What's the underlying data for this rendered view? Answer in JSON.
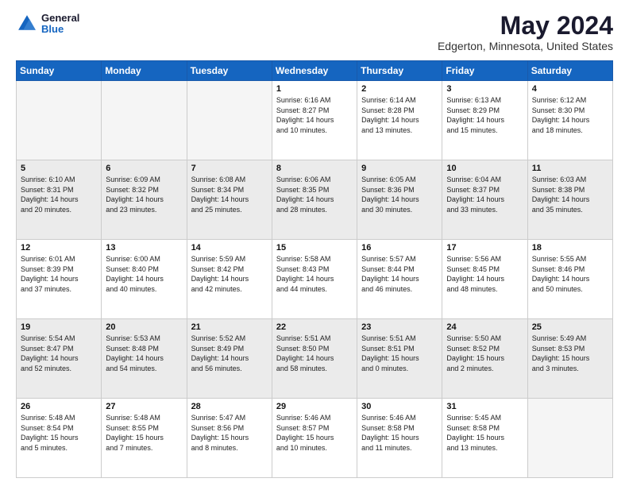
{
  "header": {
    "logo_line1": "General",
    "logo_line2": "Blue",
    "month": "May 2024",
    "location": "Edgerton, Minnesota, United States"
  },
  "days_of_week": [
    "Sunday",
    "Monday",
    "Tuesday",
    "Wednesday",
    "Thursday",
    "Friday",
    "Saturday"
  ],
  "weeks": [
    [
      {
        "day": "",
        "info": ""
      },
      {
        "day": "",
        "info": ""
      },
      {
        "day": "",
        "info": ""
      },
      {
        "day": "1",
        "info": "Sunrise: 6:16 AM\nSunset: 8:27 PM\nDaylight: 14 hours\nand 10 minutes."
      },
      {
        "day": "2",
        "info": "Sunrise: 6:14 AM\nSunset: 8:28 PM\nDaylight: 14 hours\nand 13 minutes."
      },
      {
        "day": "3",
        "info": "Sunrise: 6:13 AM\nSunset: 8:29 PM\nDaylight: 14 hours\nand 15 minutes."
      },
      {
        "day": "4",
        "info": "Sunrise: 6:12 AM\nSunset: 8:30 PM\nDaylight: 14 hours\nand 18 minutes."
      }
    ],
    [
      {
        "day": "5",
        "info": "Sunrise: 6:10 AM\nSunset: 8:31 PM\nDaylight: 14 hours\nand 20 minutes."
      },
      {
        "day": "6",
        "info": "Sunrise: 6:09 AM\nSunset: 8:32 PM\nDaylight: 14 hours\nand 23 minutes."
      },
      {
        "day": "7",
        "info": "Sunrise: 6:08 AM\nSunset: 8:34 PM\nDaylight: 14 hours\nand 25 minutes."
      },
      {
        "day": "8",
        "info": "Sunrise: 6:06 AM\nSunset: 8:35 PM\nDaylight: 14 hours\nand 28 minutes."
      },
      {
        "day": "9",
        "info": "Sunrise: 6:05 AM\nSunset: 8:36 PM\nDaylight: 14 hours\nand 30 minutes."
      },
      {
        "day": "10",
        "info": "Sunrise: 6:04 AM\nSunset: 8:37 PM\nDaylight: 14 hours\nand 33 minutes."
      },
      {
        "day": "11",
        "info": "Sunrise: 6:03 AM\nSunset: 8:38 PM\nDaylight: 14 hours\nand 35 minutes."
      }
    ],
    [
      {
        "day": "12",
        "info": "Sunrise: 6:01 AM\nSunset: 8:39 PM\nDaylight: 14 hours\nand 37 minutes."
      },
      {
        "day": "13",
        "info": "Sunrise: 6:00 AM\nSunset: 8:40 PM\nDaylight: 14 hours\nand 40 minutes."
      },
      {
        "day": "14",
        "info": "Sunrise: 5:59 AM\nSunset: 8:42 PM\nDaylight: 14 hours\nand 42 minutes."
      },
      {
        "day": "15",
        "info": "Sunrise: 5:58 AM\nSunset: 8:43 PM\nDaylight: 14 hours\nand 44 minutes."
      },
      {
        "day": "16",
        "info": "Sunrise: 5:57 AM\nSunset: 8:44 PM\nDaylight: 14 hours\nand 46 minutes."
      },
      {
        "day": "17",
        "info": "Sunrise: 5:56 AM\nSunset: 8:45 PM\nDaylight: 14 hours\nand 48 minutes."
      },
      {
        "day": "18",
        "info": "Sunrise: 5:55 AM\nSunset: 8:46 PM\nDaylight: 14 hours\nand 50 minutes."
      }
    ],
    [
      {
        "day": "19",
        "info": "Sunrise: 5:54 AM\nSunset: 8:47 PM\nDaylight: 14 hours\nand 52 minutes."
      },
      {
        "day": "20",
        "info": "Sunrise: 5:53 AM\nSunset: 8:48 PM\nDaylight: 14 hours\nand 54 minutes."
      },
      {
        "day": "21",
        "info": "Sunrise: 5:52 AM\nSunset: 8:49 PM\nDaylight: 14 hours\nand 56 minutes."
      },
      {
        "day": "22",
        "info": "Sunrise: 5:51 AM\nSunset: 8:50 PM\nDaylight: 14 hours\nand 58 minutes."
      },
      {
        "day": "23",
        "info": "Sunrise: 5:51 AM\nSunset: 8:51 PM\nDaylight: 15 hours\nand 0 minutes."
      },
      {
        "day": "24",
        "info": "Sunrise: 5:50 AM\nSunset: 8:52 PM\nDaylight: 15 hours\nand 2 minutes."
      },
      {
        "day": "25",
        "info": "Sunrise: 5:49 AM\nSunset: 8:53 PM\nDaylight: 15 hours\nand 3 minutes."
      }
    ],
    [
      {
        "day": "26",
        "info": "Sunrise: 5:48 AM\nSunset: 8:54 PM\nDaylight: 15 hours\nand 5 minutes."
      },
      {
        "day": "27",
        "info": "Sunrise: 5:48 AM\nSunset: 8:55 PM\nDaylight: 15 hours\nand 7 minutes."
      },
      {
        "day": "28",
        "info": "Sunrise: 5:47 AM\nSunset: 8:56 PM\nDaylight: 15 hours\nand 8 minutes."
      },
      {
        "day": "29",
        "info": "Sunrise: 5:46 AM\nSunset: 8:57 PM\nDaylight: 15 hours\nand 10 minutes."
      },
      {
        "day": "30",
        "info": "Sunrise: 5:46 AM\nSunset: 8:58 PM\nDaylight: 15 hours\nand 11 minutes."
      },
      {
        "day": "31",
        "info": "Sunrise: 5:45 AM\nSunset: 8:58 PM\nDaylight: 15 hours\nand 13 minutes."
      },
      {
        "day": "",
        "info": ""
      }
    ]
  ]
}
